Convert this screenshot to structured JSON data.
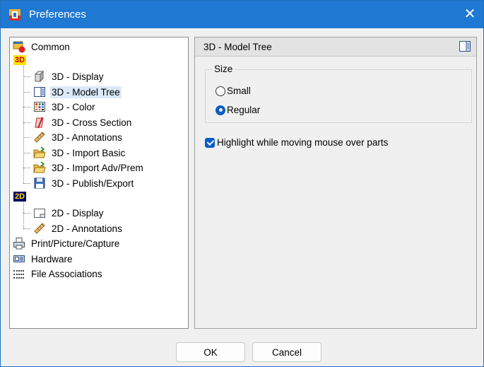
{
  "window": {
    "title": "Preferences",
    "close_glyph": "✕"
  },
  "tree": {
    "common": "Common",
    "hdr3d": "3D",
    "hdr2d": "2D",
    "items3d": [
      "3D - Display",
      "3D - Model Tree",
      "3D - Color",
      "3D - Cross Section",
      "3D - Annotations",
      "3D - Import Basic",
      "3D - Import Adv/Prem",
      "3D - Publish/Export"
    ],
    "items2d": [
      "2D - Display",
      "2D - Annotations"
    ],
    "print": "Print/Picture/Capture",
    "hardware": "Hardware",
    "file_assoc": "File Associations",
    "selected": "3D - Model Tree"
  },
  "panel": {
    "title": "3D - Model Tree",
    "size_group": "Size",
    "radio_small": "Small",
    "radio_regular": "Regular",
    "selected_size": "Regular",
    "highlight_label": "Highlight while moving mouse over parts",
    "highlight_checked": true
  },
  "buttons": {
    "ok": "OK",
    "cancel": "Cancel"
  }
}
